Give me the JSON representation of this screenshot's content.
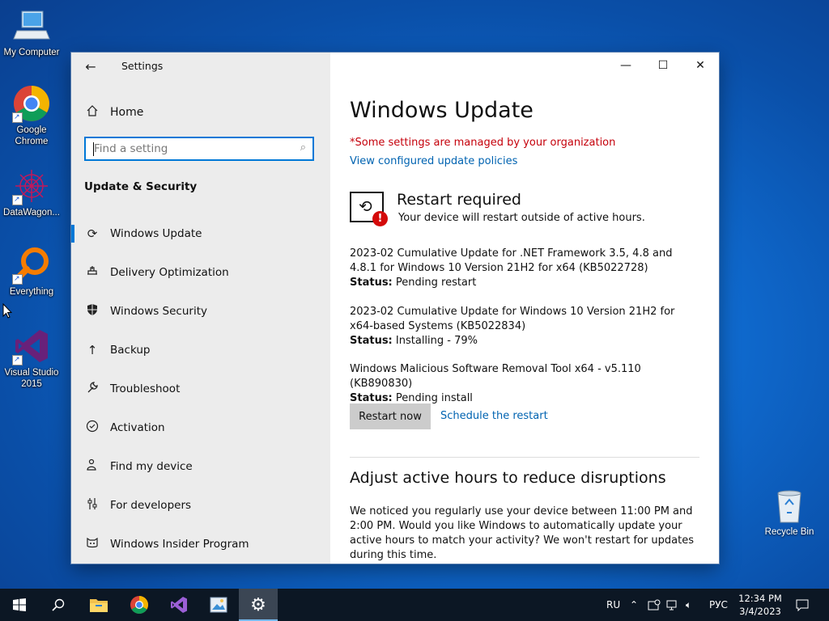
{
  "desktop": {
    "icons": [
      {
        "label": "My Computer"
      },
      {
        "label": "Google\nChrome"
      },
      {
        "label": "DataWagon..."
      },
      {
        "label": "Everything"
      },
      {
        "label": "Visual Studio\n2015"
      }
    ],
    "recycle_bin": "Recycle Bin"
  },
  "window": {
    "title": "Settings",
    "nav": {
      "home": "Home",
      "search_placeholder": "Find a setting",
      "section": "Update & Security",
      "items": [
        {
          "label": "Windows Update",
          "icon": "refresh-icon"
        },
        {
          "label": "Delivery Optimization",
          "icon": "delivery-icon"
        },
        {
          "label": "Windows Security",
          "icon": "shield-icon"
        },
        {
          "label": "Backup",
          "icon": "backup-arrow-icon"
        },
        {
          "label": "Troubleshoot",
          "icon": "wrench-icon"
        },
        {
          "label": "Activation",
          "icon": "check-circle-icon"
        },
        {
          "label": "Find my device",
          "icon": "person-locate-icon"
        },
        {
          "label": "For developers",
          "icon": "sliders-icon"
        },
        {
          "label": "Windows Insider Program",
          "icon": "insider-cat-icon"
        }
      ]
    },
    "content": {
      "title": "Windows Update",
      "managed_notice": "*Some settings are managed by your organization",
      "policies_link": "View configured update policies",
      "restart_title": "Restart required",
      "restart_subtitle": "Your device will restart outside of active hours.",
      "updates": [
        {
          "name": "2023-02 Cumulative Update for .NET Framework 3.5, 4.8 and 4.8.1 for Windows 10 Version 21H2 for x64 (KB5022728)",
          "status_label": "Status:",
          "status": "Pending restart"
        },
        {
          "name": "2023-02 Cumulative Update for Windows 10 Version 21H2 for x64-based Systems (KB5022834)",
          "status_label": "Status:",
          "status": "Installing - 79%"
        },
        {
          "name": "Windows Malicious Software Removal Tool x64 - v5.110 (KB890830)",
          "status_label": "Status:",
          "status": "Pending install"
        }
      ],
      "restart_now": "Restart now",
      "schedule": "Schedule the restart",
      "active_hours_title": "Adjust active hours to reduce disruptions",
      "active_hours_text": "We noticed you regularly use your device between 11:00 PM and 2:00 PM. Would you like Windows to automatically update your active hours to match your activity? We won't restart for updates during this time."
    }
  },
  "taskbar": {
    "lang": "RU",
    "input_lang": "РУС",
    "time": "12:34 PM",
    "date": "3/4/2023"
  }
}
